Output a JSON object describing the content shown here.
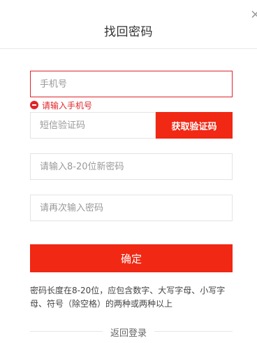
{
  "dialog": {
    "title": "找回密码",
    "close_symbol": "×"
  },
  "form": {
    "phone": {
      "placeholder": "手机号",
      "value": ""
    },
    "phone_error": "请输入手机号",
    "sms_code": {
      "placeholder": "短信验证码",
      "value": ""
    },
    "sms_button_label": "获取验证码",
    "new_password": {
      "placeholder": "请输入8-20位新密码",
      "value": ""
    },
    "confirm_password": {
      "placeholder": "请再次输入密码",
      "value": ""
    },
    "confirm_button_label": "确定"
  },
  "hint": "密码长度在8-20位，应包含数字、大写字母、小写字母、符号（除空格）的两种或两种以上",
  "back_link": "返回登录",
  "colors": {
    "accent": "#f02814",
    "error": "#e0242a",
    "border": "#e3e3e3"
  },
  "icons": [
    "close-icon",
    "error-icon"
  ]
}
